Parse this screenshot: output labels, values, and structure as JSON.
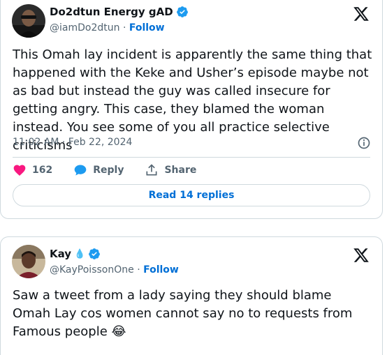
{
  "tweets": [
    {
      "display_name": "Do2dtun Energy gAD",
      "handle": "@iamDo2dtun",
      "separator": "·",
      "follow_label": "Follow",
      "text": "This Omah lay incident is apparently the same thing that happened with the Keke and Usher’s episode maybe not as bad but instead the guy was called insecure for getting angry. This case, they blamed the woman instead. You see some of you all practice selective criticisms",
      "timestamp": "11:02 AM · Feb 22, 2024",
      "like_count": "162",
      "reply_label": "Reply",
      "share_label": "Share",
      "read_replies_label": "Read 14 replies"
    },
    {
      "display_name": "Kay",
      "name_emoji": "💧",
      "handle": "@KayPoissonOne",
      "separator": "·",
      "follow_label": "Follow",
      "text": "Saw a tweet from a lady saying they should blame Omah Lay cos women cannot say no to requests from Famous people",
      "text_emoji": "😂"
    }
  ],
  "colors": {
    "like": "#f91880",
    "accent": "#006fd6",
    "verified": "#1d9bf0",
    "muted": "#536471",
    "border": "#cfd9de"
  },
  "icons": [
    "verified-badge-icon",
    "x-logo-icon",
    "heart-icon",
    "reply-bubble-icon",
    "share-icon",
    "info-icon"
  ]
}
